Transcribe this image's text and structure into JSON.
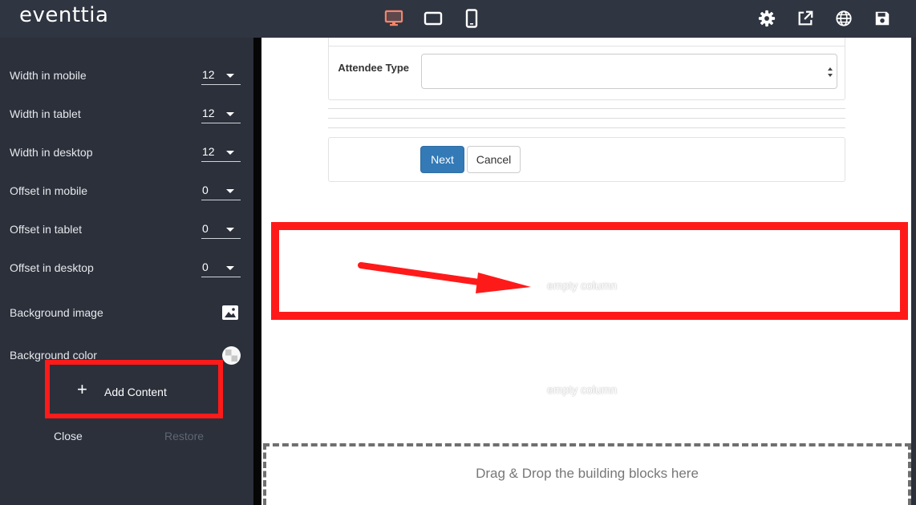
{
  "app": {
    "logo": "eventtia"
  },
  "toolbar": {
    "icons": [
      {
        "name": "desktop-icon",
        "active": true,
        "color": "#f0846c"
      },
      {
        "name": "tablet-icon",
        "active": false
      },
      {
        "name": "mobile-icon",
        "active": false
      },
      {
        "name": "gear-icon"
      },
      {
        "name": "external-link-icon"
      },
      {
        "name": "globe-icon"
      },
      {
        "name": "save-icon"
      }
    ]
  },
  "sidebar": {
    "rows": [
      {
        "label": "Width in mobile",
        "value": "12"
      },
      {
        "label": "Width in tablet",
        "value": "12"
      },
      {
        "label": "Width in desktop",
        "value": "12"
      },
      {
        "label": "Offset in mobile",
        "value": "0"
      },
      {
        "label": "Offset in tablet",
        "value": "0"
      },
      {
        "label": "Offset in desktop",
        "value": "0"
      }
    ],
    "background_image_label": "Background image",
    "background_color_label": "Background color",
    "add_content_label": "Add Content",
    "close_label": "Close",
    "restore_label": "Restore"
  },
  "canvas": {
    "attendee_label": "Attendee Type",
    "attendee_select_value": "",
    "next_label": "Next",
    "cancel_label": "Cancel",
    "empty_column_1": "empty column",
    "empty_column_2": "empty column",
    "dropzone_text": "Drag & Drop the building blocks here"
  },
  "colors": {
    "highlight": "#ff1a1a",
    "primary_button": "#337ab7",
    "active_icon": "#f0846c"
  }
}
